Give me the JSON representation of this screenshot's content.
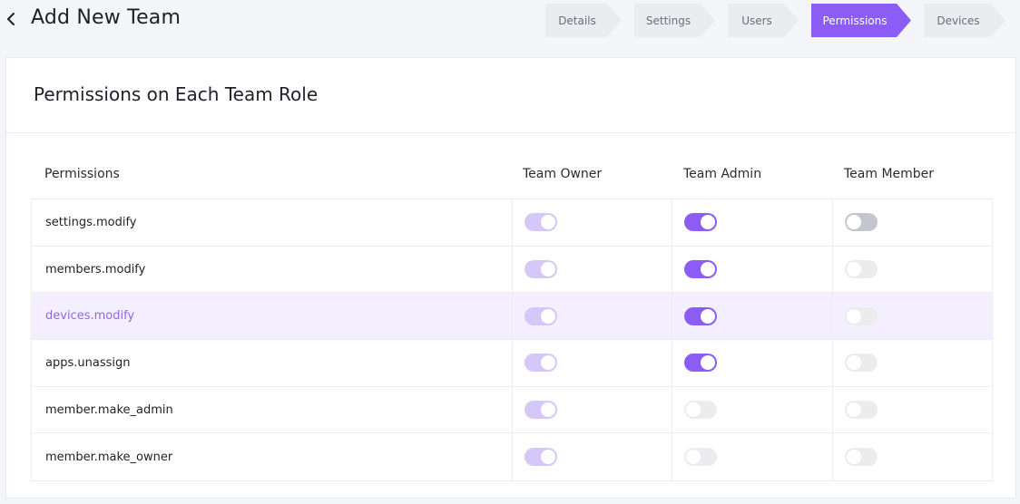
{
  "header": {
    "title": "Add New Team",
    "back_icon": "chevron-left-icon"
  },
  "stepper": {
    "steps": [
      {
        "label": "Details",
        "active": false
      },
      {
        "label": "Settings",
        "active": false
      },
      {
        "label": "Users",
        "active": false
      },
      {
        "label": "Permissions",
        "active": true
      },
      {
        "label": "Devices",
        "active": false
      }
    ],
    "active_color": "#8b5cf6"
  },
  "card": {
    "title": "Permissions on Each Team Role",
    "columns": {
      "permissions": "Permissions",
      "owner": "Team Owner",
      "admin": "Team Admin",
      "member": "Team Member"
    },
    "rows": [
      {
        "name": "settings.modify",
        "owner": {
          "on": true,
          "disabled": true
        },
        "admin": {
          "on": true,
          "disabled": false
        },
        "member": {
          "on": false,
          "disabled": false
        },
        "highlight": false
      },
      {
        "name": "members.modify",
        "owner": {
          "on": true,
          "disabled": true
        },
        "admin": {
          "on": true,
          "disabled": false
        },
        "member": {
          "on": false,
          "disabled": true
        },
        "highlight": false
      },
      {
        "name": "devices.modify",
        "owner": {
          "on": true,
          "disabled": true
        },
        "admin": {
          "on": true,
          "disabled": false
        },
        "member": {
          "on": false,
          "disabled": true
        },
        "highlight": true
      },
      {
        "name": "apps.unassign",
        "owner": {
          "on": true,
          "disabled": true
        },
        "admin": {
          "on": true,
          "disabled": false
        },
        "member": {
          "on": false,
          "disabled": true
        },
        "highlight": false
      },
      {
        "name": "member.make_admin",
        "owner": {
          "on": true,
          "disabled": true
        },
        "admin": {
          "on": false,
          "disabled": true
        },
        "member": {
          "on": false,
          "disabled": true
        },
        "highlight": false
      },
      {
        "name": "member.make_owner",
        "owner": {
          "on": true,
          "disabled": true
        },
        "admin": {
          "on": false,
          "disabled": true
        },
        "member": {
          "on": false,
          "disabled": true
        },
        "highlight": false
      }
    ]
  },
  "colors": {
    "accent": "#8b5cf6",
    "accent_light": "#d5c8f8",
    "highlight_row": "#f3efff",
    "highlight_text": "#8f69e8"
  }
}
